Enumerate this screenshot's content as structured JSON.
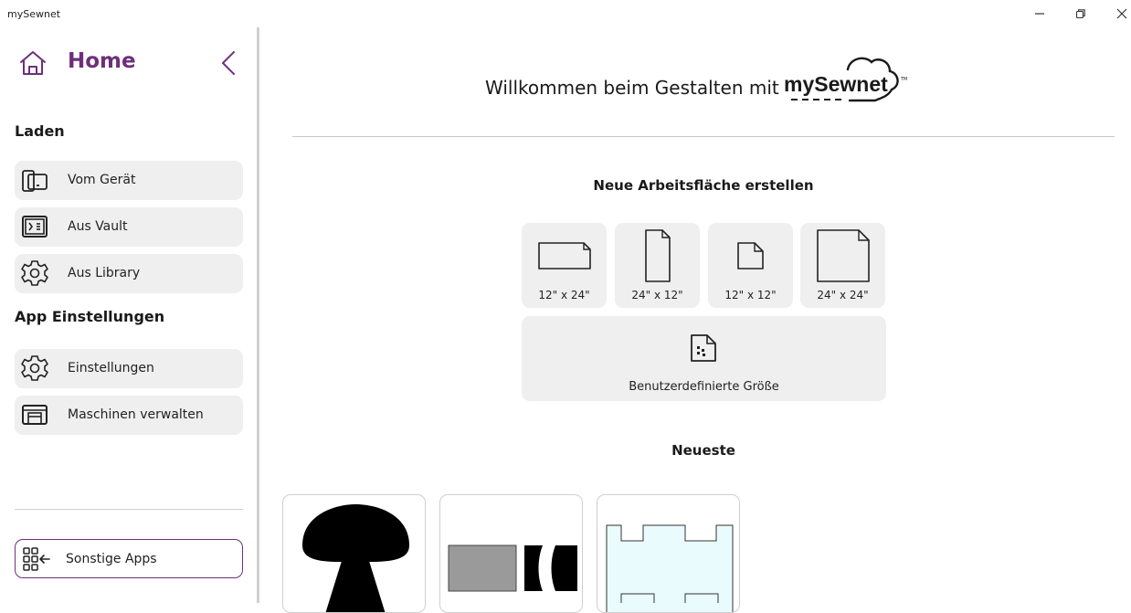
{
  "window": {
    "title": "mySewnet",
    "minimize_glyph": "–",
    "maximize_glyph": "restore-icon",
    "close_glyph": "×"
  },
  "sidebar": {
    "home_label": "Home",
    "sections": [
      {
        "title": "Laden"
      },
      {
        "title": "App Einstellungen"
      }
    ],
    "load_items": [
      {
        "label": "Vom Gerät",
        "icon": "device-icon"
      },
      {
        "label": "Aus Vault",
        "icon": "vault-icon"
      },
      {
        "label": "Aus Library",
        "icon": "library-gear-icon"
      }
    ],
    "settings_items": [
      {
        "label": "Einstellungen",
        "icon": "gear-icon"
      },
      {
        "label": "Maschinen verwalten",
        "icon": "machine-icon"
      }
    ],
    "other_apps_label": "Sonstige Apps"
  },
  "main": {
    "welcome": "Willkommen beim Gestalten mit",
    "logo_text": "mySewnet",
    "new_canvas_title": "Neue Arbeitsfläche erstellen",
    "sizes": [
      {
        "label": "12\" x 24\"",
        "icon": "landscape-page-icon"
      },
      {
        "label": "24\" x 12\"",
        "icon": "portrait-page-icon"
      },
      {
        "label": "12\" x 12\"",
        "icon": "small-square-page-icon"
      },
      {
        "label": "24\" x 24\"",
        "icon": "large-square-page-icon"
      }
    ],
    "custom_size_label": "Benutzerdefinierte Größe",
    "recent_title": "Neueste"
  },
  "colors": {
    "accent": "#6d2f7b",
    "button_bg": "#efefef",
    "divider": "#cfcfcf",
    "thumb_light_blue": "#e9fbfd"
  }
}
